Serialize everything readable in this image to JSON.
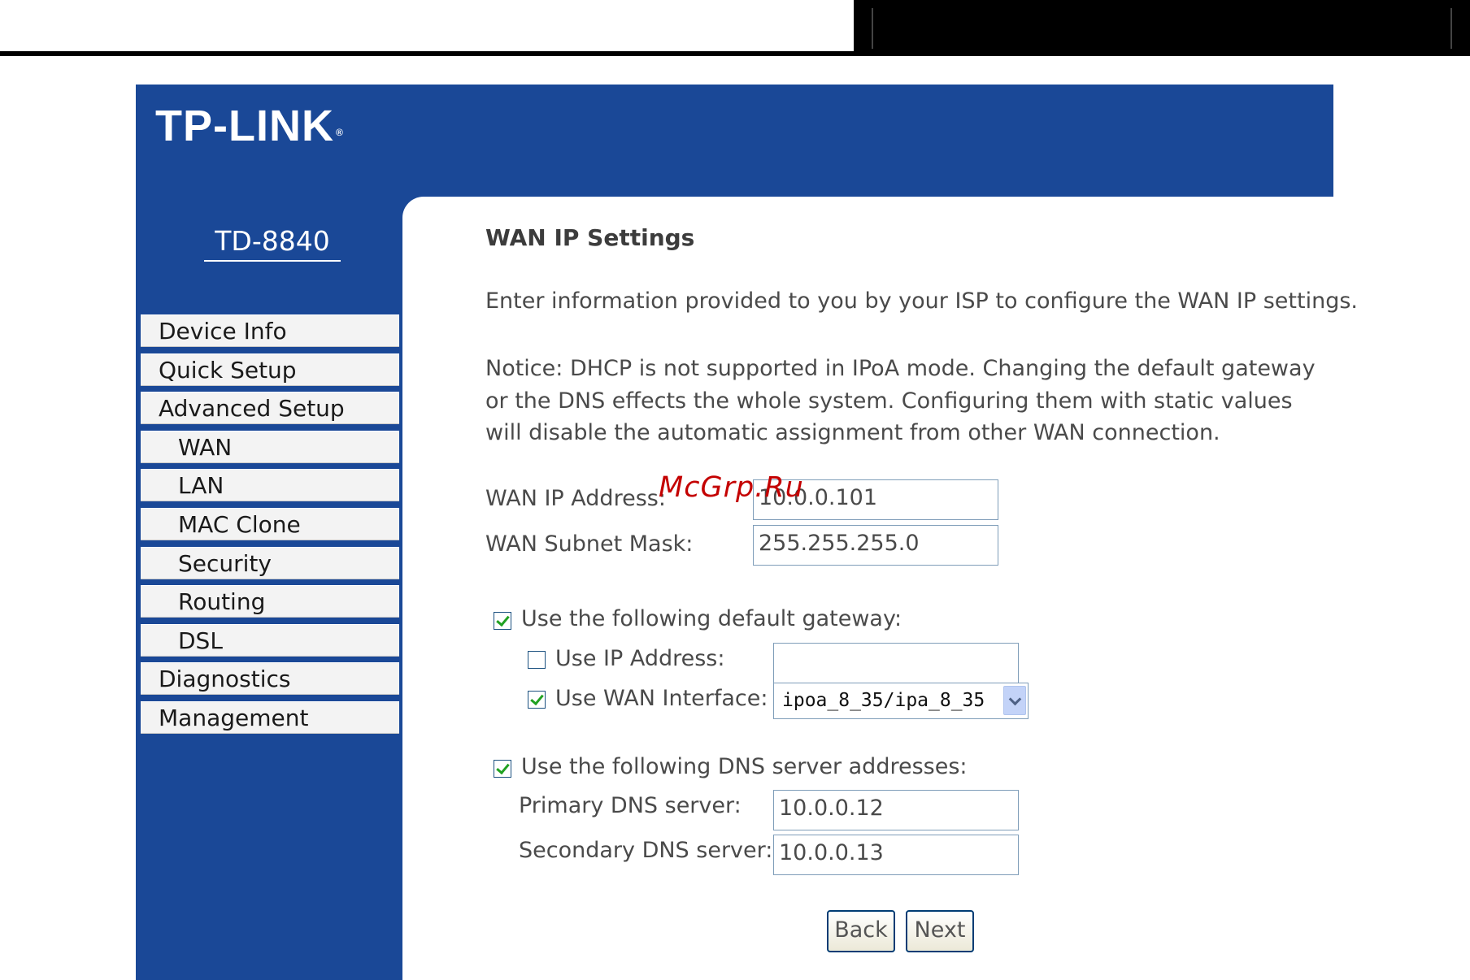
{
  "brand": {
    "logo": "TP-LINK",
    "model": "TD-8840"
  },
  "nav": {
    "items": [
      {
        "label": "Device Info"
      },
      {
        "label": "Quick Setup"
      },
      {
        "label": "Advanced Setup"
      },
      {
        "label": "WAN"
      },
      {
        "label": "LAN"
      },
      {
        "label": "MAC Clone"
      },
      {
        "label": "Security"
      },
      {
        "label": "Routing"
      },
      {
        "label": "DSL"
      },
      {
        "label": "Diagnostics"
      },
      {
        "label": "Management"
      }
    ]
  },
  "page": {
    "title": "WAN IP Settings",
    "intro": "Enter information provided to you by your ISP to configure the WAN IP settings.",
    "notice": "Notice: DHCP is not supported in IPoA mode. Changing the default gateway or the DNS effects the whole system. Configuring them with static values will disable the automatic assignment from other WAN connection."
  },
  "form": {
    "wan_ip_label": "WAN IP Address:",
    "wan_ip_value": "10.0.0.101",
    "subnet_label": "WAN Subnet Mask:",
    "subnet_value": "255.255.255.0",
    "gateway_label": "Use the following default gateway:",
    "gateway_checked": true,
    "use_ip_label": "Use IP Address:",
    "use_ip_checked": false,
    "use_ip_value": "",
    "use_wan_label": "Use WAN Interface:",
    "use_wan_checked": true,
    "wan_interface_selected": "ipoa_8_35/ipa_8_35",
    "dns_label": "Use the following DNS server addresses:",
    "dns_checked": true,
    "primary_dns_label": "Primary DNS server:",
    "primary_dns_value": "10.0.0.12",
    "secondary_dns_label": "Secondary DNS server:",
    "secondary_dns_value": "10.0.0.13"
  },
  "buttons": {
    "back": "Back",
    "next": "Next"
  },
  "watermark": "McGrp.Ru",
  "colors": {
    "frame": "#1a4897",
    "check": "#21a121",
    "input_border": "#7f9db9"
  }
}
